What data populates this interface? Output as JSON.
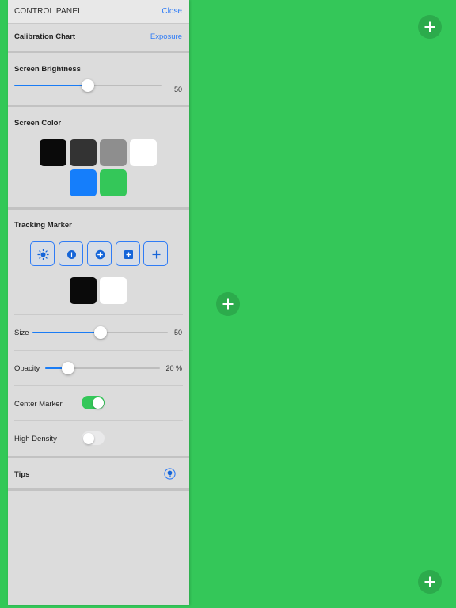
{
  "header": {
    "title": "CONTROL PANEL",
    "close_label": "Close"
  },
  "calibration": {
    "label": "Calibration Chart",
    "link": "Exposure"
  },
  "brightness": {
    "label": "Screen Brightness",
    "value": 50,
    "value_text": "50"
  },
  "screen_color": {
    "label": "Screen Color",
    "swatches": [
      "#0a0a0a",
      "#333333",
      "#8e8e8e",
      "#ffffff",
      "#157efb",
      "#34c759"
    ]
  },
  "tracking": {
    "label": "Tracking Marker",
    "markers": [
      "sun-icon",
      "info-dot-icon",
      "plus-circle-icon",
      "plus-square-icon",
      "plus-icon"
    ],
    "colors": [
      "#0a0a0a",
      "#ffffff"
    ]
  },
  "size": {
    "label": "Size",
    "value": 50,
    "value_text": "50"
  },
  "opacity": {
    "label": "Opacity",
    "value": 20,
    "value_text": "20 %"
  },
  "center_marker": {
    "label": "Center Marker",
    "on": true
  },
  "high_density": {
    "label": "High Density",
    "on": false
  },
  "tips": {
    "label": "Tips",
    "icon": "lightbulb-icon"
  },
  "colors": {
    "accent": "#2f7cf6",
    "background": "#34c759",
    "fab": "#2cab4c",
    "toggle_on": "#34c759",
    "toggle_off": "#e9e9ea"
  }
}
